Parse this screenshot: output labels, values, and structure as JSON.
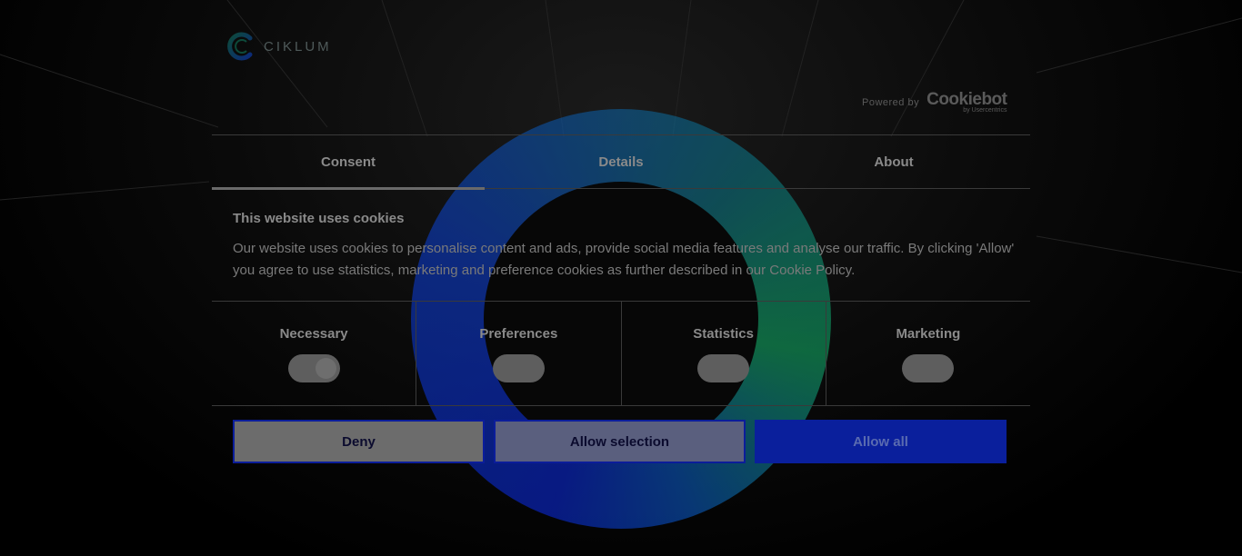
{
  "brand": {
    "name": "CIKLUM",
    "logo_icon": "ciklum-c-logo-icon"
  },
  "powered_by": {
    "label": "Powered by",
    "provider": "Cookiebot",
    "provider_sub": "by Usercentrics"
  },
  "tabs": [
    {
      "label": "Consent",
      "active": true
    },
    {
      "label": "Details",
      "active": false
    },
    {
      "label": "About",
      "active": false
    }
  ],
  "content": {
    "heading": "This website uses cookies",
    "description": "Our website uses cookies to personalise content and ads, provide social media features and analyse our traffic. By clicking 'Allow' you agree to use statistics, marketing and preference cookies as further described in our Cookie Policy."
  },
  "toggles": [
    {
      "label": "Necessary",
      "state": "on",
      "locked": true
    },
    {
      "label": "Preferences",
      "state": "off"
    },
    {
      "label": "Statistics",
      "state": "off"
    },
    {
      "label": "Marketing",
      "state": "off"
    }
  ],
  "buttons": {
    "deny": "Deny",
    "allow_selection": "Allow selection",
    "allow_all": "Allow all"
  },
  "colors": {
    "accent_blue": "#0a1f9c",
    "ring_green": "#12b46a"
  }
}
